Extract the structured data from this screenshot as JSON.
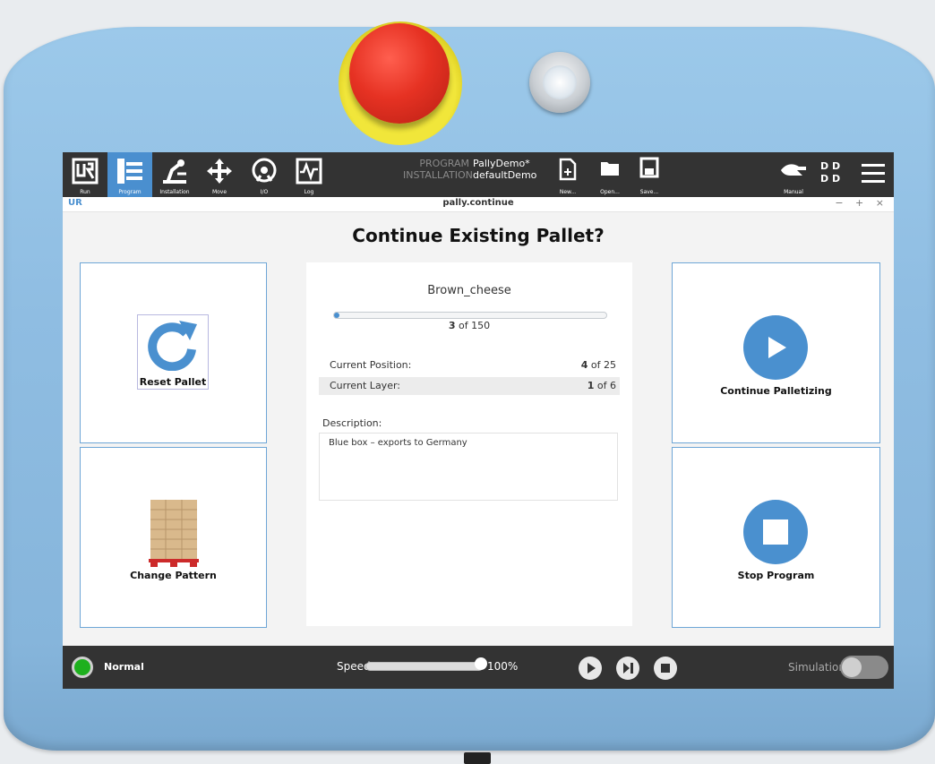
{
  "colors": {
    "accent": "#4a90cf",
    "topbar": "#333333",
    "status_ok": "#1db01d",
    "estop": "#e63223"
  },
  "nav": [
    {
      "label": "Run",
      "icon": "ur-logo-icon"
    },
    {
      "label": "Program",
      "icon": "program-tree-icon",
      "active": true
    },
    {
      "label": "Installation",
      "icon": "robot-arm-icon"
    },
    {
      "label": "Move",
      "icon": "move-arrows-icon"
    },
    {
      "label": "I/O",
      "icon": "io-icon"
    },
    {
      "label": "Log",
      "icon": "log-waveform-icon"
    }
  ],
  "program": {
    "program_key": "PROGRAM",
    "program_value": "PallyDemo*",
    "installation_key": "INSTALLATION",
    "installation_value": "defaultDemo"
  },
  "file": {
    "new_label": "New...",
    "open_label": "Open...",
    "save_label": "Save..."
  },
  "manual": {
    "label": "Manual"
  },
  "dd": {
    "line1": "D D",
    "line2": "D D"
  },
  "window": {
    "title": "pally.continue",
    "logo": "UR",
    "controls": "− + ×"
  },
  "heading": "Continue Existing Pallet?",
  "tiles": {
    "reset": "Reset Pallet",
    "change": "Change Pattern",
    "continue": "Continue Palletizing",
    "stop": "Stop Program"
  },
  "pallet": {
    "name": "Brown_cheese",
    "progress_current": "3",
    "progress_of": "of 150",
    "progress_fraction": 0.02,
    "position_label": "Current Position:",
    "position_current": "4",
    "position_of": "of 25",
    "layer_label": "Current Layer:",
    "layer_current": "1",
    "layer_of": "of 6",
    "description_label": "Description:",
    "description_value": "Blue box – exports to Germany"
  },
  "bottom": {
    "status": "Normal",
    "speed_label": "Speed",
    "speed_value": "100%",
    "speed_fraction": 1.0,
    "simulation_label": "Simulation"
  }
}
